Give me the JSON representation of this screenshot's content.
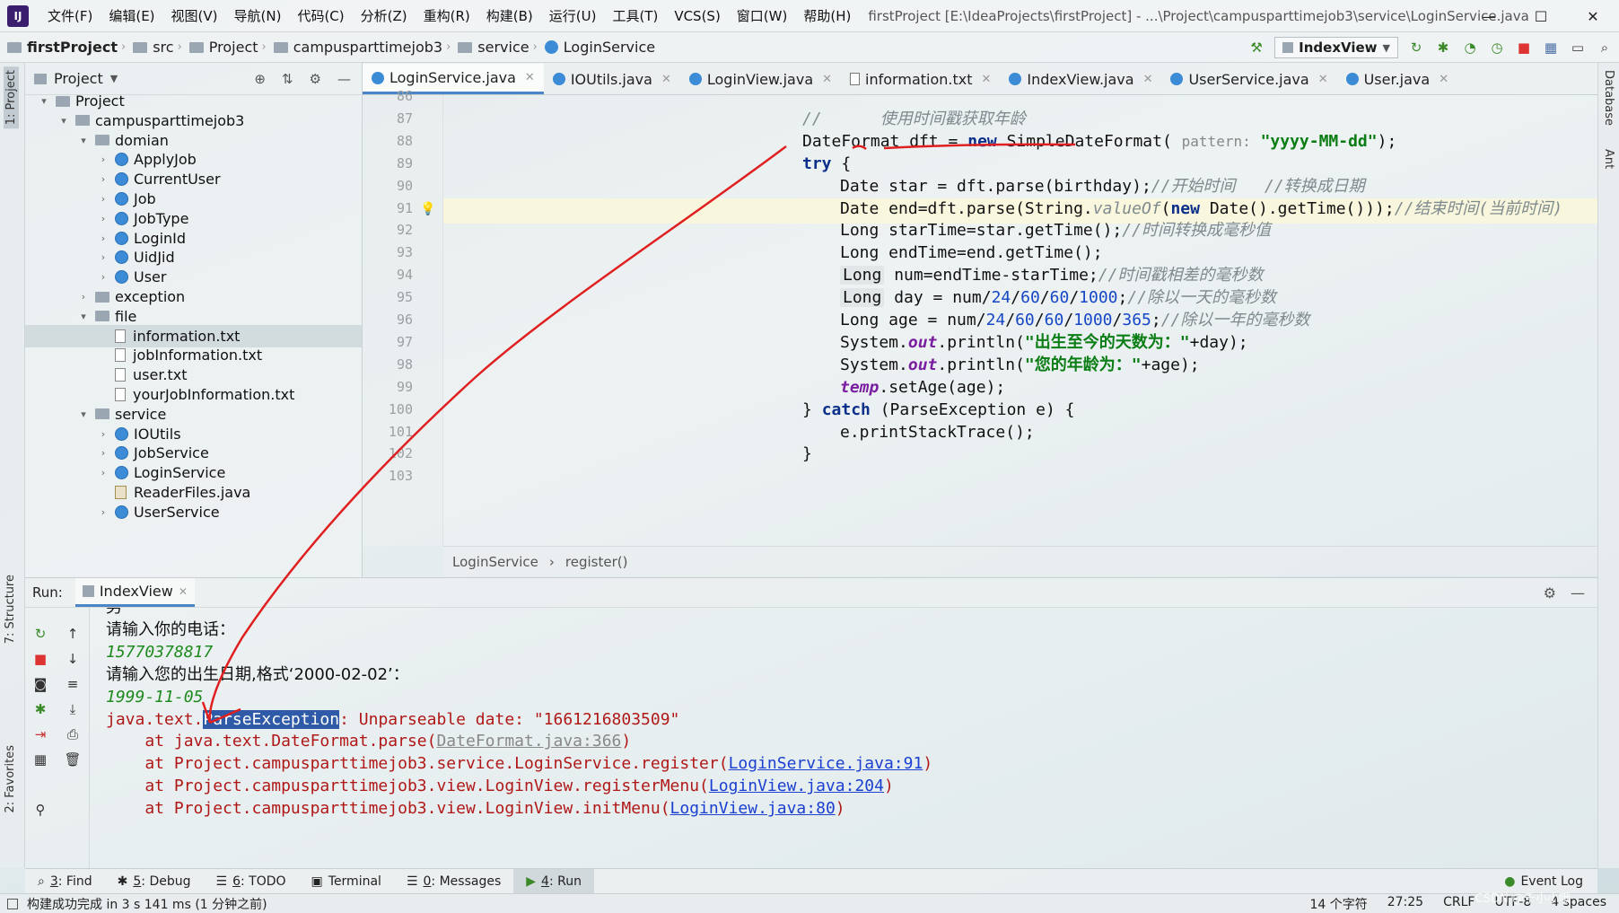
{
  "menu": {
    "items": [
      "文件(F)",
      "编辑(E)",
      "视图(V)",
      "导航(N)",
      "代码(C)",
      "分析(Z)",
      "重构(R)",
      "构建(B)",
      "运行(U)",
      "工具(T)",
      "VCS(S)",
      "窗口(W)",
      "帮助(H)"
    ],
    "window_title": "firstProject [E:\\IdeaProjects\\firstProject] - ...\\Project\\campusparttimejob3\\service\\LoginService.java"
  },
  "breadcrumb": [
    "firstProject",
    "src",
    "Project",
    "campusparttimejob3",
    "service",
    "LoginService"
  ],
  "run_config": "IndexView",
  "left_strip": {
    "project": "1: Project",
    "structure": "7: Structure",
    "favorites": "2: Favorites"
  },
  "right_strip": {
    "database": "Database",
    "ant": "Ant"
  },
  "project_panel": {
    "title": "Project",
    "tree": [
      {
        "label": "Project",
        "icon": "folder",
        "arrow": "down",
        "indent": 0
      },
      {
        "label": "campusparttimejob3",
        "icon": "folder",
        "arrow": "down",
        "indent": 1
      },
      {
        "label": "domian",
        "icon": "folder",
        "arrow": "down",
        "indent": 2
      },
      {
        "label": "ApplyJob",
        "icon": "class",
        "arrow": "right",
        "indent": 3
      },
      {
        "label": "CurrentUser",
        "icon": "class",
        "arrow": "right",
        "indent": 3
      },
      {
        "label": "Job",
        "icon": "class",
        "arrow": "right",
        "indent": 3
      },
      {
        "label": "JobType",
        "icon": "class",
        "arrow": "right",
        "indent": 3
      },
      {
        "label": "LoginId",
        "icon": "class",
        "arrow": "right",
        "indent": 3
      },
      {
        "label": "UidJid",
        "icon": "class",
        "arrow": "right",
        "indent": 3
      },
      {
        "label": "User",
        "icon": "class",
        "arrow": "right",
        "indent": 3
      },
      {
        "label": "exception",
        "icon": "folder",
        "arrow": "right",
        "indent": 2
      },
      {
        "label": "file",
        "icon": "folder",
        "arrow": "down",
        "indent": 2
      },
      {
        "label": "information.txt",
        "icon": "file",
        "arrow": "",
        "indent": 3,
        "selected": true
      },
      {
        "label": "jobInformation.txt",
        "icon": "file",
        "arrow": "",
        "indent": 3
      },
      {
        "label": "user.txt",
        "icon": "file",
        "arrow": "",
        "indent": 3
      },
      {
        "label": "yourJobInformation.txt",
        "icon": "file",
        "arrow": "",
        "indent": 3
      },
      {
        "label": "service",
        "icon": "folder",
        "arrow": "down",
        "indent": 2
      },
      {
        "label": "IOUtils",
        "icon": "class",
        "arrow": "right",
        "indent": 3
      },
      {
        "label": "JobService",
        "icon": "class",
        "arrow": "right",
        "indent": 3
      },
      {
        "label": "LoginService",
        "icon": "class",
        "arrow": "right",
        "indent": 3
      },
      {
        "label": "ReaderFiles.java",
        "icon": "java",
        "arrow": "",
        "indent": 3
      },
      {
        "label": "UserService",
        "icon": "class",
        "arrow": "right",
        "indent": 3
      }
    ]
  },
  "editor": {
    "tabs": [
      {
        "label": "LoginService.java",
        "icon": "class",
        "active": true
      },
      {
        "label": "IOUtils.java",
        "icon": "class"
      },
      {
        "label": "LoginView.java",
        "icon": "class"
      },
      {
        "label": "information.txt",
        "icon": "txt"
      },
      {
        "label": "IndexView.java",
        "icon": "class"
      },
      {
        "label": "UserService.java",
        "icon": "class"
      },
      {
        "label": "User.java",
        "icon": "class"
      }
    ],
    "line_numbers": [
      "86",
      "87",
      "88",
      "89",
      "90",
      "91",
      "92",
      "93",
      "94",
      "95",
      "96",
      "97",
      "98",
      "99",
      "100",
      "101",
      "102",
      "103"
    ],
    "highlight_line": "91",
    "lines": [
      {
        "line": "86",
        "indent": 0,
        "parts": []
      },
      {
        "line": "87",
        "indent": 1,
        "parts": [
          {
            "t": "//      ",
            "c": "cmt"
          },
          {
            "t": "使用时间戳获取年龄",
            "c": "cmt"
          }
        ]
      },
      {
        "line": "88",
        "indent": 1,
        "parts": [
          {
            "t": "DateFormat dft = ",
            "c": ""
          },
          {
            "t": "new",
            "c": "kw"
          },
          {
            "t": " SimpleDateFormat( ",
            "c": ""
          },
          {
            "t": "pattern:",
            "c": "hint"
          },
          {
            "t": " ",
            "c": ""
          },
          {
            "t": "\"yyyy-MM-dd\"",
            "c": "str"
          },
          {
            "t": ");",
            "c": ""
          }
        ]
      },
      {
        "line": "89",
        "indent": 1,
        "parts": [
          {
            "t": "try",
            "c": "kw"
          },
          {
            "t": " {",
            "c": ""
          }
        ]
      },
      {
        "line": "90",
        "indent": 2,
        "parts": [
          {
            "t": "Date star = dft.parse(birthday);",
            "c": ""
          },
          {
            "t": "//开始时间   //转换成日期",
            "c": "cmt"
          }
        ]
      },
      {
        "line": "91",
        "indent": 2,
        "parts": [
          {
            "t": "Date end=dft.parse(String.",
            "c": ""
          },
          {
            "t": "valueOf",
            "c": "cmt"
          },
          {
            "t": "(",
            "c": ""
          },
          {
            "t": "new",
            "c": "kw"
          },
          {
            "t": " Date().getTime()));",
            "c": ""
          },
          {
            "t": "//结束时间(当前时间)",
            "c": "cmt"
          }
        ]
      },
      {
        "line": "92",
        "indent": 2,
        "parts": [
          {
            "t": "Long starTime=star.getTime();",
            "c": ""
          },
          {
            "t": "//时间转换成毫秒值",
            "c": "cmt"
          }
        ]
      },
      {
        "line": "93",
        "indent": 2,
        "parts": [
          {
            "t": "Long endTime=end.getTime();",
            "c": ""
          }
        ]
      },
      {
        "line": "94",
        "indent": 2,
        "parts": [
          {
            "t": "Long",
            "c": "hlbox"
          },
          {
            "t": " num=endTime-starTime;",
            "c": ""
          },
          {
            "t": "//时间戳相差的毫秒数",
            "c": "cmt"
          }
        ]
      },
      {
        "line": "95",
        "indent": 2,
        "parts": [
          {
            "t": "Long",
            "c": "hlbox"
          },
          {
            "t": " day = num/",
            "c": ""
          },
          {
            "t": "24",
            "c": "num"
          },
          {
            "t": "/",
            "c": ""
          },
          {
            "t": "60",
            "c": "num"
          },
          {
            "t": "/",
            "c": ""
          },
          {
            "t": "60",
            "c": "num"
          },
          {
            "t": "/",
            "c": ""
          },
          {
            "t": "1000",
            "c": "num"
          },
          {
            "t": ";",
            "c": ""
          },
          {
            "t": "//除以一天的毫秒数",
            "c": "cmt"
          }
        ]
      },
      {
        "line": "96",
        "indent": 2,
        "parts": [
          {
            "t": "Long age = num/",
            "c": ""
          },
          {
            "t": "24",
            "c": "num"
          },
          {
            "t": "/",
            "c": ""
          },
          {
            "t": "60",
            "c": "num"
          },
          {
            "t": "/",
            "c": ""
          },
          {
            "t": "60",
            "c": "num"
          },
          {
            "t": "/",
            "c": ""
          },
          {
            "t": "1000",
            "c": "num"
          },
          {
            "t": "/",
            "c": ""
          },
          {
            "t": "365",
            "c": "num"
          },
          {
            "t": ";",
            "c": ""
          },
          {
            "t": "//除以一年的毫秒数",
            "c": "cmt"
          }
        ]
      },
      {
        "line": "97",
        "indent": 2,
        "parts": [
          {
            "t": "System.",
            "c": ""
          },
          {
            "t": "out",
            "c": "fld"
          },
          {
            "t": ".println(",
            "c": ""
          },
          {
            "t": "\"出生至今的天数为：\"",
            "c": "str"
          },
          {
            "t": "+day);",
            "c": ""
          }
        ]
      },
      {
        "line": "98",
        "indent": 2,
        "parts": [
          {
            "t": "System.",
            "c": ""
          },
          {
            "t": "out",
            "c": "fld"
          },
          {
            "t": ".println(",
            "c": ""
          },
          {
            "t": "\"您的年龄为：\"",
            "c": "str"
          },
          {
            "t": "+age);",
            "c": ""
          }
        ]
      },
      {
        "line": "99",
        "indent": 2,
        "parts": [
          {
            "t": "temp",
            "c": "fld"
          },
          {
            "t": ".setAge(age);",
            "c": ""
          }
        ]
      },
      {
        "line": "100",
        "indent": 1,
        "parts": [
          {
            "t": "} ",
            "c": ""
          },
          {
            "t": "catch",
            "c": "kw"
          },
          {
            "t": " (ParseException e) {",
            "c": ""
          }
        ]
      },
      {
        "line": "101",
        "indent": 2,
        "parts": [
          {
            "t": "e.printStackTrace();",
            "c": ""
          }
        ]
      },
      {
        "line": "102",
        "indent": 1,
        "parts": [
          {
            "t": "}",
            "c": ""
          }
        ]
      },
      {
        "line": "103",
        "indent": 0,
        "parts": []
      }
    ],
    "breadcrumb": [
      "LoginService",
      "register()"
    ]
  },
  "run_panel": {
    "label": "Run:",
    "tab": "IndexView",
    "console": [
      {
        "kind": "out",
        "parts": [
          {
            "t": "男",
            "c": "c-out"
          }
        ]
      },
      {
        "kind": "out",
        "parts": [
          {
            "t": "请输入你的电话：",
            "c": "c-out"
          }
        ]
      },
      {
        "kind": "in",
        "parts": [
          {
            "t": "15770378817",
            "c": "c-in"
          }
        ]
      },
      {
        "kind": "out",
        "parts": [
          {
            "t": "请输入您的出生日期,格式‘2000-02-02’：",
            "c": "c-out"
          }
        ]
      },
      {
        "kind": "in",
        "parts": [
          {
            "t": "1999-11-05",
            "c": "c-in"
          }
        ]
      },
      {
        "kind": "err",
        "parts": [
          {
            "t": "java.text.",
            "c": "c-err"
          },
          {
            "t": "ParseException",
            "c": "c-err c-sel"
          },
          {
            "t": ": Unparseable date: \"1661216803509\"",
            "c": "c-err"
          }
        ]
      },
      {
        "kind": "err",
        "parts": [
          {
            "t": "    at java.text.DateFormat.parse(",
            "c": "c-err"
          },
          {
            "t": "DateFormat.java:366",
            "c": "c-err c-dim"
          },
          {
            "t": ")",
            "c": "c-err"
          }
        ]
      },
      {
        "kind": "err",
        "parts": [
          {
            "t": "    at Project.campusparttimejob3.service.LoginService.register(",
            "c": "c-err"
          },
          {
            "t": "LoginService.java:91",
            "c": "c-err c-link"
          },
          {
            "t": ")",
            "c": "c-err"
          }
        ]
      },
      {
        "kind": "err",
        "parts": [
          {
            "t": "    at Project.campusparttimejob3.view.LoginView.registerMenu(",
            "c": "c-err"
          },
          {
            "t": "LoginView.java:204",
            "c": "c-err c-link"
          },
          {
            "t": ")",
            "c": "c-err"
          }
        ]
      },
      {
        "kind": "err",
        "parts": [
          {
            "t": "    at Project.campusparttimejob3.view.LoginView.initMenu(",
            "c": "c-err"
          },
          {
            "t": "LoginView.java:80",
            "c": "c-err c-link"
          },
          {
            "t": ")",
            "c": "c-err"
          }
        ]
      }
    ]
  },
  "bottom_tabs": [
    {
      "num": "3",
      "label": ": Find",
      "icon": "search-icon"
    },
    {
      "num": "5",
      "label": ": Debug",
      "icon": "bug-icon"
    },
    {
      "num": "6",
      "label": ": TODO",
      "icon": "list-icon"
    },
    {
      "num": "",
      "label": "Terminal",
      "icon": "terminal-icon"
    },
    {
      "num": "0",
      "label": ": Messages",
      "icon": "messages-icon"
    },
    {
      "num": "4",
      "label": ": Run",
      "icon": "run-icon",
      "active": true
    }
  ],
  "event_log": "Event Log",
  "status": {
    "message": "构建成功完成 in 3 s 141 ms (1 分钟之前)",
    "chars": "14 个字符",
    "position": "27:25",
    "line_sep": "CRLF",
    "encoding": "UTF-8",
    "indent": "4 spaces"
  },
  "watermark": "CSDN @千小小哦",
  "colors": {
    "accent": "#4a86c7",
    "annotation": "#e02020",
    "selection": "#2e5aa7"
  }
}
